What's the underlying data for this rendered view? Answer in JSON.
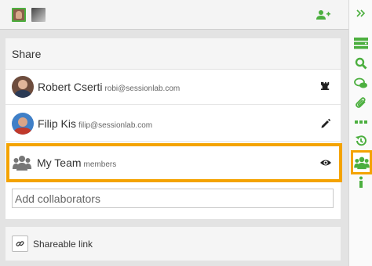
{
  "share": {
    "title": "Share",
    "collaborators": [
      {
        "name": "Robert Cserti",
        "email": "robi@sessionlab.com",
        "permission": "owner-rook-icon"
      },
      {
        "name": "Filip Kis",
        "email": "filip@sessionlab.com",
        "permission": "edit-pencil-icon"
      },
      {
        "name": "My Team",
        "email": "members",
        "permission": "view-eye-icon"
      }
    ],
    "add_placeholder": "Add collaborators"
  },
  "link": {
    "label": "Shareable link"
  },
  "colors": {
    "accent_green": "#4caf3f",
    "highlight_orange": "#f4a300"
  },
  "sidebar_icons": [
    "collapse-chevrons-icon",
    "blocks-icon",
    "search-icon",
    "comments-icon",
    "attachment-icon",
    "more-dots-icon",
    "history-icon",
    "team-icon",
    "info-icon"
  ]
}
